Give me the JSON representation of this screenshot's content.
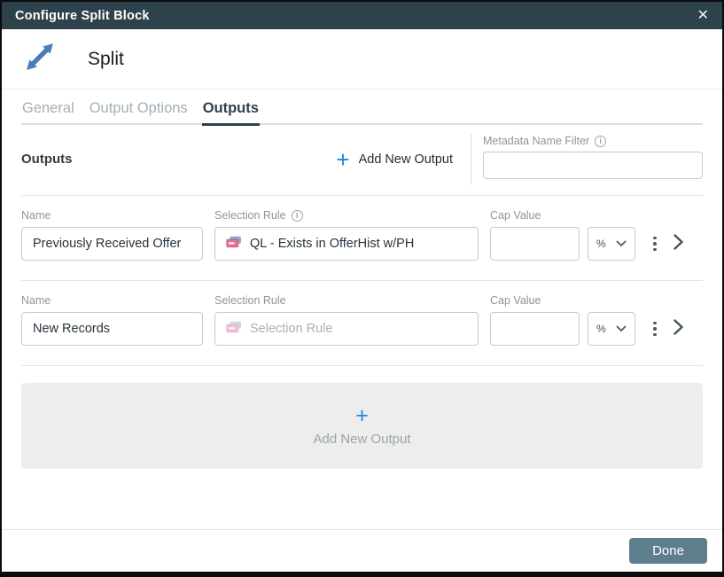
{
  "titlebar": {
    "title": "Configure Split Block"
  },
  "block": {
    "name": "Split"
  },
  "tabs": [
    {
      "label": "General"
    },
    {
      "label": "Output Options"
    },
    {
      "label": "Outputs"
    }
  ],
  "outputs_header": {
    "section_label": "Outputs",
    "add_button_label": "Add New Output",
    "metadata_filter_label": "Metadata Name Filter",
    "metadata_filter_value": ""
  },
  "rows": [
    {
      "name_label": "Name",
      "name_value": "Previously Received Offer",
      "rule_label": "Selection Rule",
      "rule_value": "QL - Exists in OfferHist w/PH",
      "cap_label": "Cap Value",
      "cap_value": "",
      "unit": "%"
    },
    {
      "name_label": "Name",
      "name_value": "New Records",
      "rule_label": "Selection Rule",
      "rule_placeholder": "Selection Rule",
      "cap_label": "Cap Value",
      "cap_value": "",
      "unit": "%"
    }
  ],
  "add_output_box": {
    "label": "Add New Output"
  },
  "footer": {
    "done_label": "Done"
  },
  "icons": {
    "close": "✕",
    "plus": "+",
    "info": "i"
  },
  "colors": {
    "header_dark": "#2e424b",
    "accent_blue": "#1e88e5",
    "split_icon_blue": "#4a7cb5",
    "rule_icon_pink": "#e0739c",
    "rule_icon_back_blue": "#8fa8c8",
    "done_button": "#5e7e8e"
  }
}
